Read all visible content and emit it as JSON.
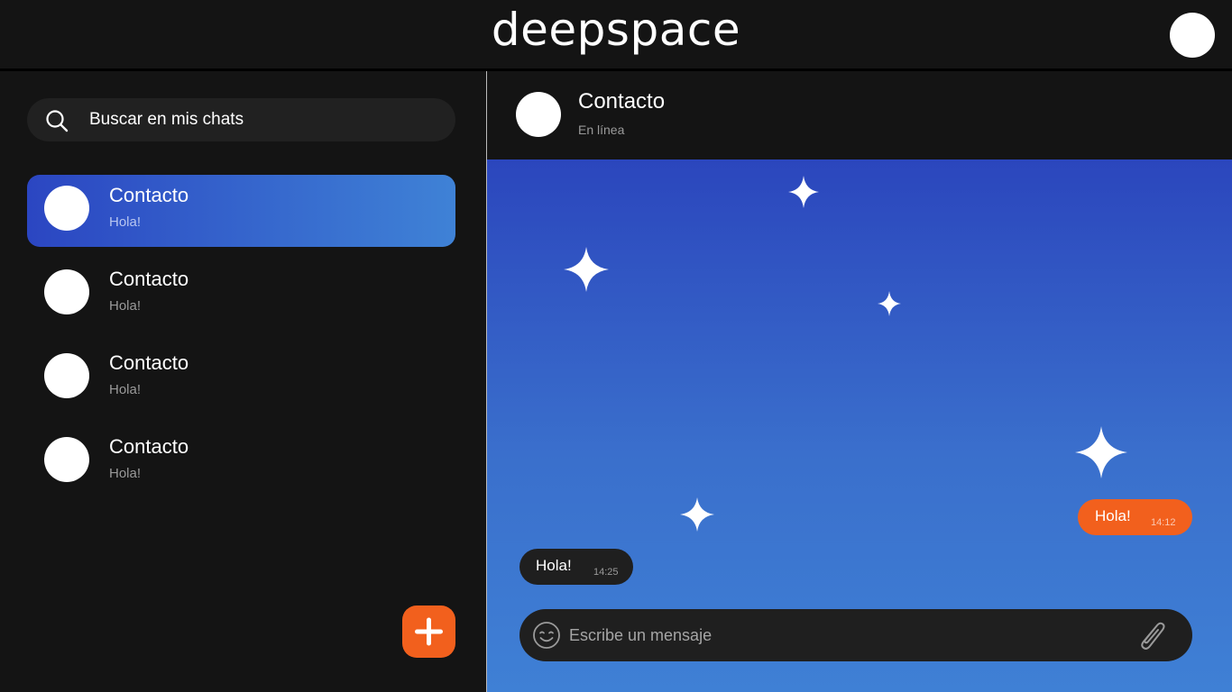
{
  "app": {
    "brand": "deepspace"
  },
  "search": {
    "placeholder": "Buscar en mis chats",
    "icon": "search-icon"
  },
  "chats": [
    {
      "name": "Contacto",
      "preview": "Hola!",
      "active": true
    },
    {
      "name": "Contacto",
      "preview": "Hola!",
      "active": false
    },
    {
      "name": "Contacto",
      "preview": "Hola!",
      "active": false
    },
    {
      "name": "Contacto",
      "preview": "Hola!",
      "active": false
    }
  ],
  "fab": {
    "icon": "plus-icon"
  },
  "conversation": {
    "contact_name": "Contacto",
    "status": "En línea",
    "messages": [
      {
        "direction": "out",
        "text": "Hola!",
        "time": "14:12"
      },
      {
        "direction": "in",
        "text": "Hola!",
        "time": "14:25"
      }
    ]
  },
  "composer": {
    "placeholder": "Escribe un mensaje",
    "emoji_icon": "smiley-icon",
    "attach_icon": "paperclip-icon"
  },
  "colors": {
    "background": "#141414",
    "accent": "#f2601d",
    "active_chat_start": "#2b46c2",
    "active_chat_end": "#3f82d6",
    "chat_bg_top": "#2b46bd",
    "chat_bg_bottom": "#3f80d5",
    "bubble_in": "#1f1f1f"
  }
}
